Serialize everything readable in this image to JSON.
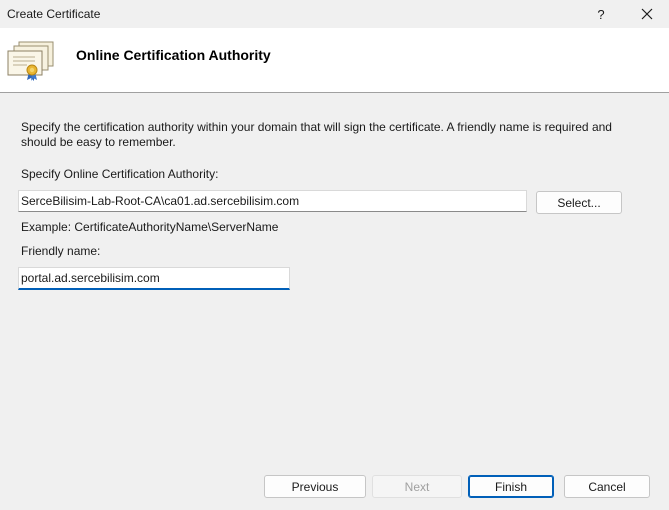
{
  "window": {
    "title": "Create Certificate",
    "help_label": "?",
    "close_label": "✕"
  },
  "header": {
    "icon": "certificate-icon",
    "title": "Online Certification Authority"
  },
  "main": {
    "description": "Specify the certification authority within your domain that will sign the certificate. A friendly name is required and should be easy to remember.",
    "ca_label": "Specify Online Certification Authority:",
    "ca_value": "SerceBilisim-Lab-Root-CA\\ca01.ad.sercebilisim.com",
    "select_label": "Select...",
    "example_text": "Example: CertificateAuthorityName\\ServerName",
    "friendly_label": "Friendly name:",
    "friendly_value": "portal.ad.sercebilisim.com"
  },
  "footer": {
    "previous_label": "Previous",
    "next_label": "Next",
    "finish_label": "Finish",
    "cancel_label": "Cancel"
  },
  "colors": {
    "accent": "#005fb8",
    "background": "#f0f0f0",
    "banner": "#ffffff"
  }
}
